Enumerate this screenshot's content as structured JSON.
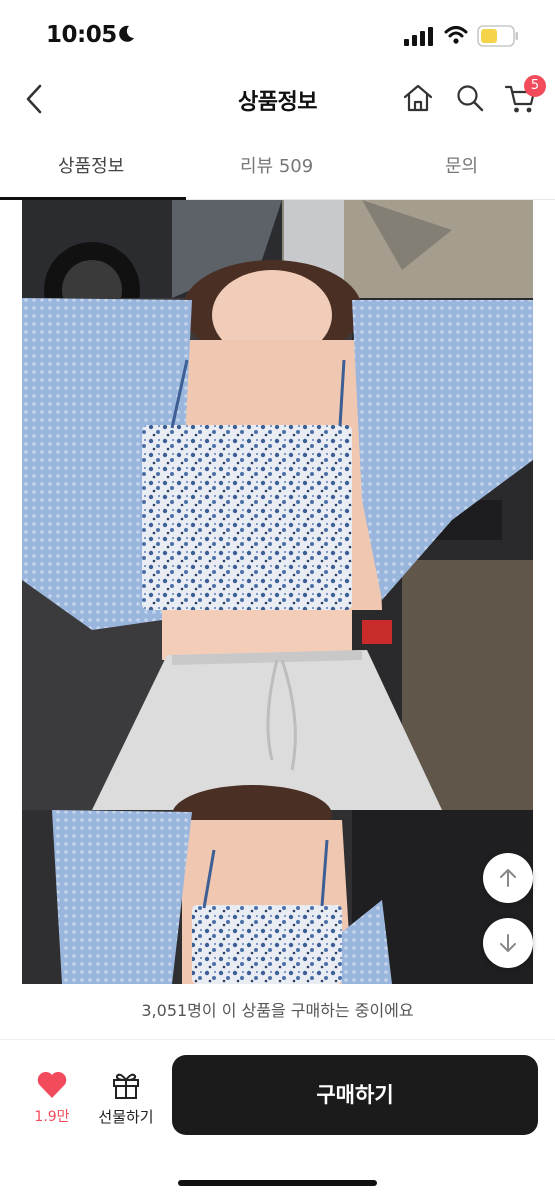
{
  "status_bar": {
    "time": "10:05"
  },
  "nav": {
    "title": "상품정보",
    "cart_count": "5"
  },
  "tabs": [
    {
      "label": "상품정보",
      "active": true
    },
    {
      "label": "리뷰 509",
      "active": false
    },
    {
      "label": "문의",
      "active": false
    }
  ],
  "notice": {
    "text": "3,051명이 이 상품을 구매하는 중이에요"
  },
  "bottom_bar": {
    "like_count": "1.9만",
    "gift_label": "선물하기",
    "buy_label": "구매하기"
  },
  "colors": {
    "accent": "#f24b5c",
    "buy_button": "#1b1b1b",
    "battery": "#f5d34a"
  },
  "icons": [
    "back-icon",
    "home-icon",
    "search-icon",
    "cart-icon",
    "heart-icon",
    "gift-icon",
    "arrow-up-icon",
    "arrow-down-icon"
  ]
}
